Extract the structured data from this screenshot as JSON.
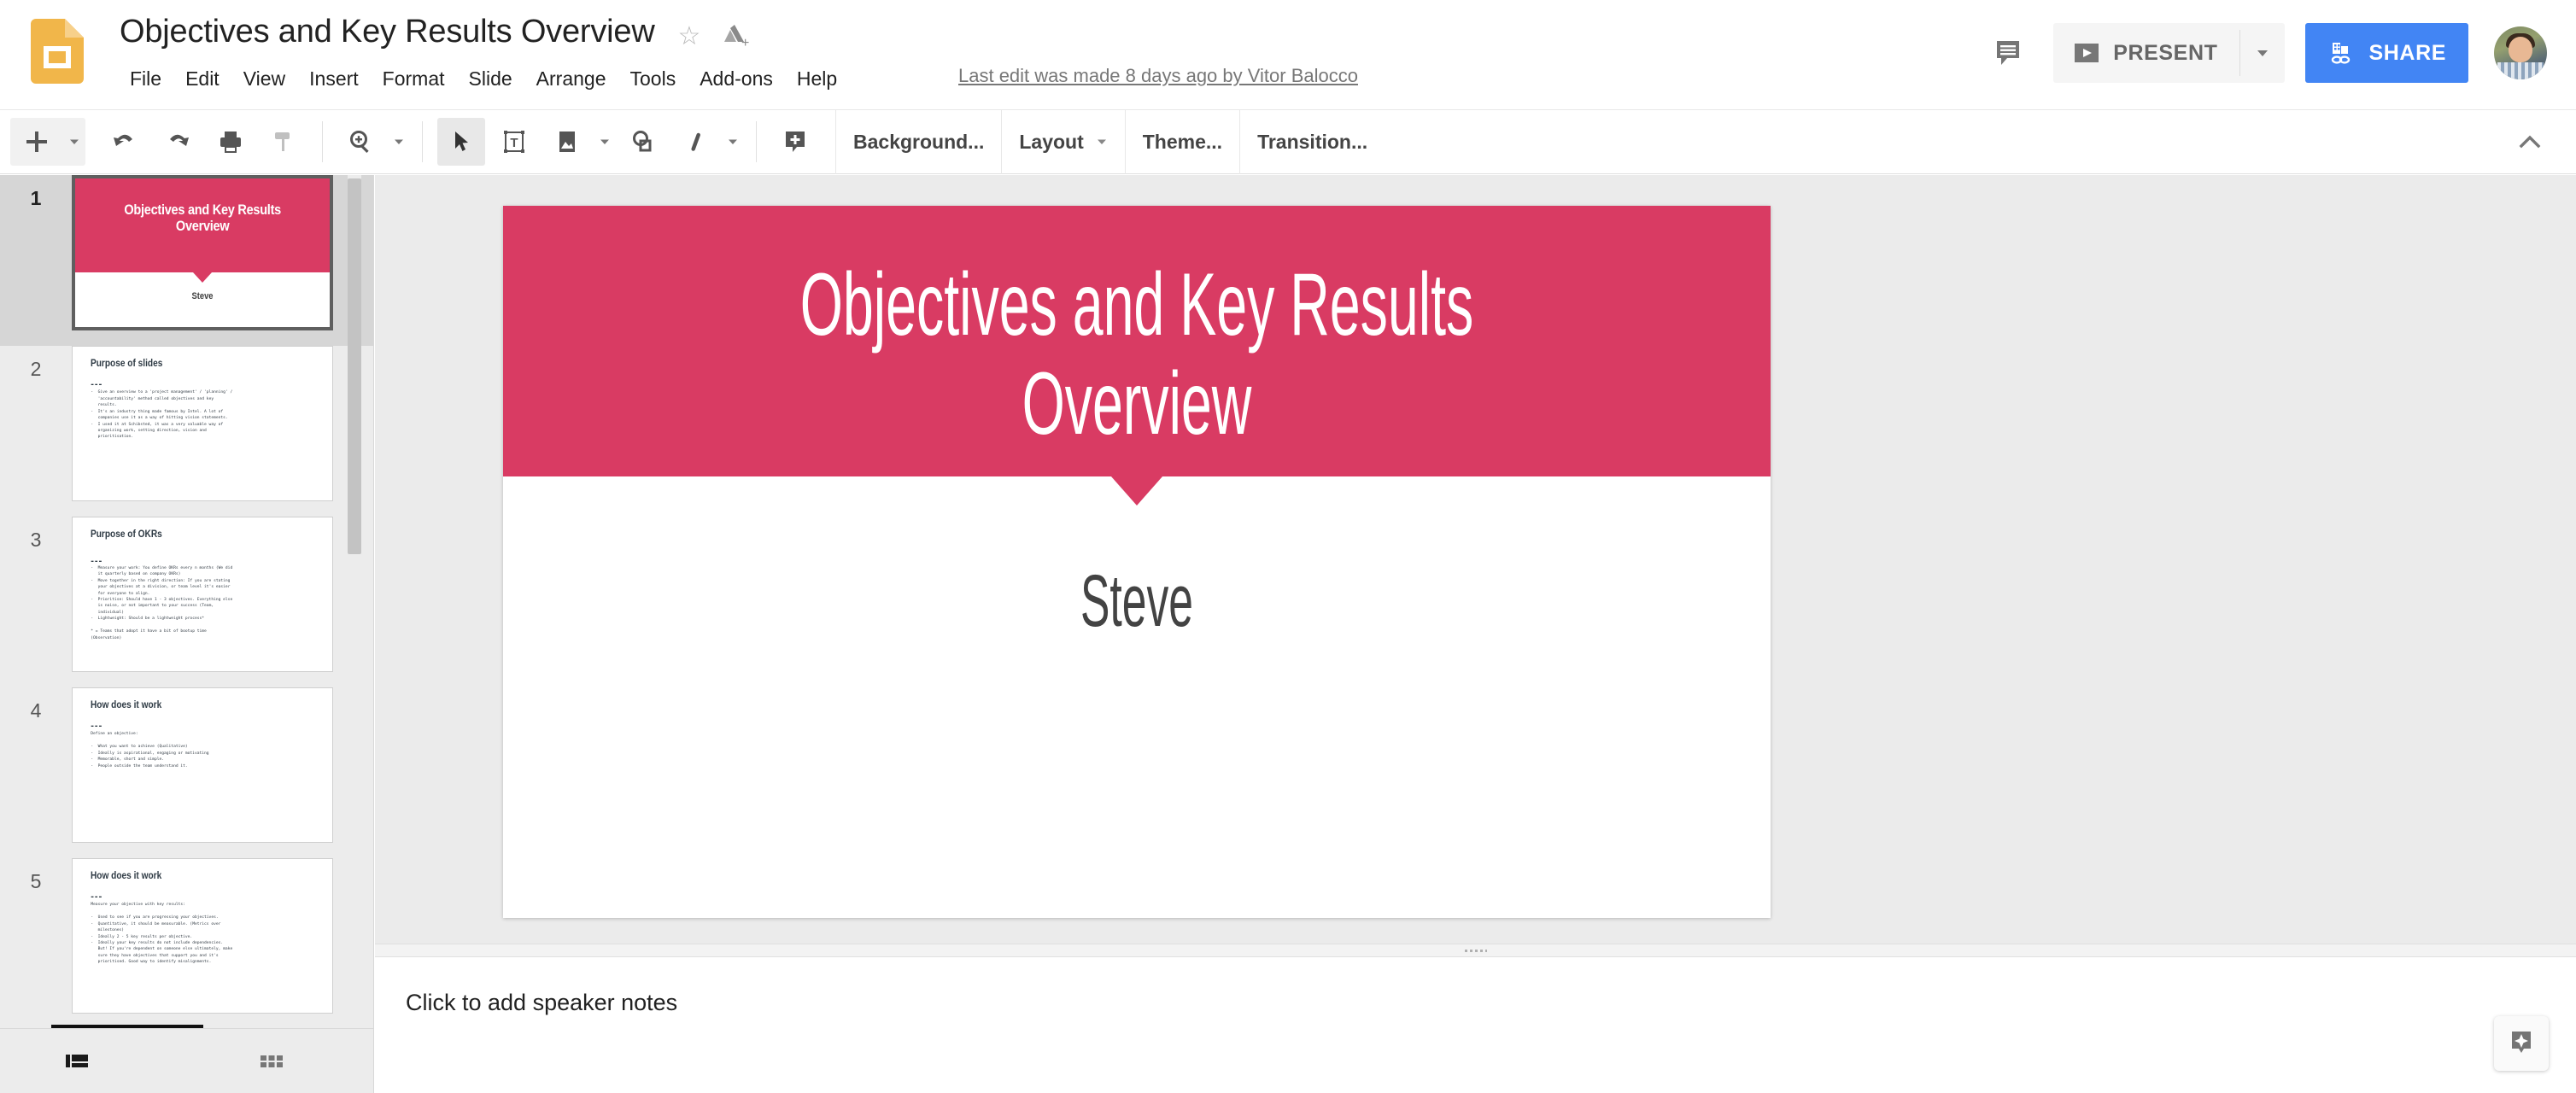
{
  "app": {
    "name": "Google Slides",
    "logo_icon": "slides-logo-icon"
  },
  "header": {
    "doc_title": "Objectives and Key Results Overview",
    "star_icon": "star-outline-icon",
    "drive_icon": "drive-move-icon",
    "menus": [
      "File",
      "Edit",
      "View",
      "Insert",
      "Format",
      "Slide",
      "Arrange",
      "Tools",
      "Add-ons",
      "Help"
    ],
    "last_edit": "Last edit was made 8 days ago by Vitor Balocco",
    "comment_icon": "comment-icon",
    "present_label": "PRESENT",
    "present_icon": "play-icon",
    "present_caret_icon": "chevron-down-icon",
    "share_label": "SHARE",
    "share_icon": "share-lock-icon",
    "avatar_alt": "user-avatar",
    "share_color": "#4285f4"
  },
  "toolbar": {
    "new_slide_icon": "plus-icon",
    "new_slide_caret_icon": "chevron-down-icon",
    "undo_icon": "undo-icon",
    "redo_icon": "redo-icon",
    "print_icon": "print-icon",
    "paint_format_icon": "paint-format-icon",
    "zoom_icon": "zoom-icon",
    "zoom_caret_icon": "chevron-down-icon",
    "select_icon": "cursor-select-icon",
    "textbox_icon": "text-box-icon",
    "image_icon": "image-icon",
    "image_caret_icon": "chevron-down-icon",
    "shape_icon": "shape-icon",
    "line_icon": "line-icon",
    "line_caret_icon": "chevron-down-icon",
    "comment_icon": "add-comment-icon",
    "background_label": "Background...",
    "layout_label": "Layout",
    "layout_caret_icon": "chevron-down-icon",
    "theme_label": "Theme...",
    "transition_label": "Transition...",
    "collapse_icon": "chevron-up-icon"
  },
  "filmstrip": {
    "selected_index": 1,
    "slides": [
      {
        "number": "1",
        "type": "title",
        "title": "Objectives and Key Results Overview",
        "subtitle": "Steve"
      },
      {
        "number": "2",
        "type": "content",
        "title": "Purpose of slides",
        "rule": "---",
        "body": "-  Give an overview to a 'project management' / 'planning' /\n   'accountability' method called objectives and key\n   results.\n-  It's an industry thing made famous by Intel. A lot of\n   companies use it as a way of hitting vision statements.\n-  I used it at Schibsted, it was a very valuable way of\n   organizing work, setting direction, vision and\n   prioritisation."
      },
      {
        "number": "3",
        "type": "content",
        "title": "Purpose of OKRs",
        "rule": "---",
        "body": "-  Measure your work: You define OKRs every n months (We did\n   it quarterly based on company OKRs)\n-  Move together in the right direction: If you are stating\n   your objectives at a division, or team level it's easier\n   for everyone to align.\n-  Prioritise: Should have 1 - 3 objectives. Everything else\n   is noise, or not important to your success (Team,\n   individual)\n-  Lightweight: Should be a lightweight process*\n\n* = Teams that adopt it have a bit of bootup time\n(Observation)"
      },
      {
        "number": "4",
        "type": "content",
        "title": "How does it work",
        "rule": "---",
        "body": "Define an objective:\n\n-  What you want to achieve (Qualitative)\n-  Ideally is aspirational, engaging or motivating\n-  Memorable, short and simple.\n-  People outside the team understand it."
      },
      {
        "number": "5",
        "type": "content",
        "title": "How does it work",
        "rule": "---",
        "body": "Measure your objective with key results:\n\n-  Used to see if you are progressing your objectives.\n-  Quantitative, it should be measurable. (Metrics over\n   milestones)\n-  Ideally 2 - 5 key results per objective.\n-  Ideally your key results do not include dependencies.\n   But! If you're dependent on someone else ultimately, make\n   sure they have objectives that support you and it's\n   prioritised. Good way to identify misalignments."
      }
    ]
  },
  "slide_canvas": {
    "title": "Objectives and Key Results Overview",
    "subtitle": "Steve",
    "banner_color": "#d93b63",
    "title_color": "#ffffff",
    "subtitle_color": "#434343",
    "background_color": "#ffffff"
  },
  "notes": {
    "placeholder": "Click to add speaker notes",
    "value": "",
    "explore_icon": "explore-sparkle-icon"
  },
  "view_bar": {
    "filmstrip_icon": "filmstrip-view-icon",
    "grid_icon": "grid-view-icon",
    "active": "filmstrip"
  }
}
